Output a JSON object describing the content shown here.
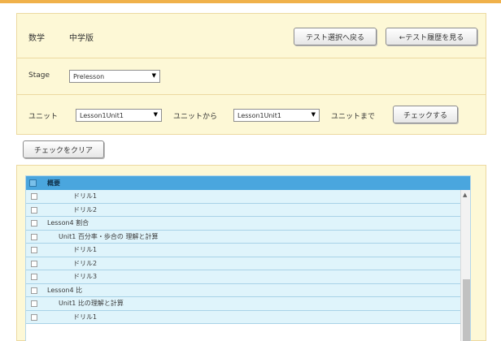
{
  "header": {
    "subject": "数学",
    "grade": "中学版",
    "back_button": "テスト選択へ戻る",
    "history_button": "←テスト履歴を見る"
  },
  "stage": {
    "label": "Stage",
    "selected": "Prelesson"
  },
  "unit": {
    "label": "ユニット",
    "from_selected": "Lesson1Unit1",
    "from_suffix": "ユニットから",
    "to_selected": "Lesson1Unit1",
    "to_suffix": "ユニットまで",
    "check_button": "チェックする"
  },
  "clear_button": "チェックをクリア",
  "grid": {
    "header": "概要",
    "rows": [
      {
        "text": "ドリル1",
        "level": 3
      },
      {
        "text": "ドリル2",
        "level": 3
      },
      {
        "text": "Lesson4 割合",
        "level": 1
      },
      {
        "text": "Unit1 百分率・歩合の 理解と計算",
        "level": 2
      },
      {
        "text": "ドリル1",
        "level": 3
      },
      {
        "text": "ドリル2",
        "level": 3
      },
      {
        "text": "ドリル3",
        "level": 3
      },
      {
        "text": "Lesson4 比",
        "level": 1
      },
      {
        "text": "Unit1 比の理解と計算",
        "level": 2
      },
      {
        "text": "ドリル1",
        "level": 3
      }
    ]
  },
  "icons": {
    "dropdown": "chevron-down-icon",
    "scroll_up": "scroll-up-icon"
  },
  "colors": {
    "accent": "#f0b14a",
    "panel": "#fdf8d6",
    "grid_header": "#4aa6de",
    "row": "#dff4fb"
  }
}
